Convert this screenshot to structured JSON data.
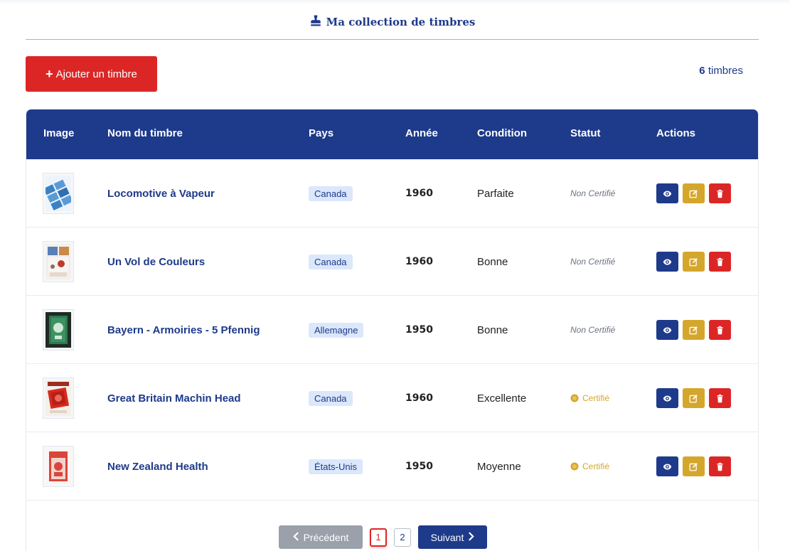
{
  "header": {
    "title": "Ma collection de timbres",
    "icon": "stamp-icon"
  },
  "toolbar": {
    "add_label": "Ajouter un timbre",
    "count_number": "6",
    "count_suffix": "timbres"
  },
  "table": {
    "columns": [
      "Image",
      "Nom du timbre",
      "Pays",
      "Année",
      "Condition",
      "Statut",
      "Actions"
    ],
    "rows": [
      {
        "name": "Locomotive à Vapeur",
        "country": "Canada",
        "year": "1960",
        "condition": "Parfaite",
        "status": "Non Certifié",
        "certified": false
      },
      {
        "name": "Un Vol de Couleurs",
        "country": "Canada",
        "year": "1960",
        "condition": "Bonne",
        "status": "Non Certifié",
        "certified": false
      },
      {
        "name": "Bayern - Armoiries - 5 Pfennig",
        "country": "Allemagne",
        "year": "1950",
        "condition": "Bonne",
        "status": "Non Certifié",
        "certified": false
      },
      {
        "name": "Great Britain Machin Head",
        "country": "Canada",
        "year": "1960",
        "condition": "Excellente",
        "status": "Certifié",
        "certified": true
      },
      {
        "name": "New Zealand Health",
        "country": "États-Unis",
        "year": "1950",
        "condition": "Moyenne",
        "status": "Certifié",
        "certified": true
      }
    ]
  },
  "pagination": {
    "prev_label": "Précédent",
    "next_label": "Suivant",
    "pages": [
      "1",
      "2"
    ],
    "current_page": "1"
  },
  "colors": {
    "primary": "#1e3a8a",
    "danger": "#dc2626",
    "gold": "#d4a72c"
  }
}
